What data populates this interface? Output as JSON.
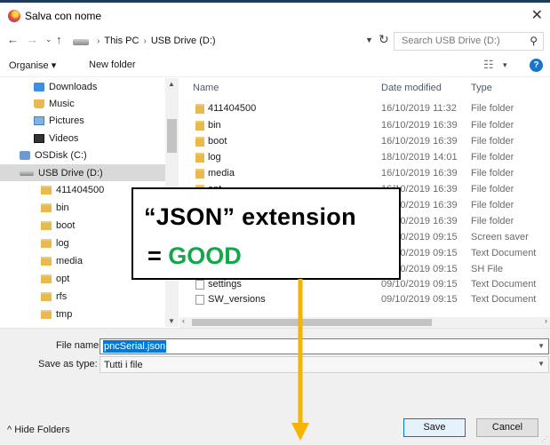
{
  "window": {
    "title": "Salva con nome",
    "close_glyph": "✕",
    "app_icon": "firefox-icon"
  },
  "nav": {
    "back_glyph": "←",
    "forward_glyph": "→",
    "recent_glyph": "⌄",
    "up_glyph": "↑",
    "breadcrumbs": [
      "This PC",
      "USB Drive (D:)"
    ],
    "breadcrumb_sep": "›",
    "refresh_glyph": "↻",
    "search_placeholder": "Search USB Drive (D:)",
    "search_glyph": "⚲"
  },
  "toolbar": {
    "organise": "Organise ▾",
    "new_folder": "New folder",
    "view_glyph": "☷",
    "view_drop": "▾",
    "help": "?"
  },
  "navpane": {
    "items": [
      {
        "label": "Downloads",
        "icon": "downloads-icon"
      },
      {
        "label": "Music",
        "icon": "music-icon"
      },
      {
        "label": "Pictures",
        "icon": "pictures-icon"
      },
      {
        "label": "Videos",
        "icon": "videos-icon"
      },
      {
        "label": "OSDisk (C:)",
        "icon": "disk-icon"
      },
      {
        "label": "USB Drive (D:)",
        "icon": "usb-drive-icon",
        "selected": true
      },
      {
        "label": "411404500",
        "icon": "folder-icon"
      },
      {
        "label": "bin",
        "icon": "folder-icon"
      },
      {
        "label": "boot",
        "icon": "folder-icon"
      },
      {
        "label": "log",
        "icon": "folder-icon"
      },
      {
        "label": "media",
        "icon": "folder-icon"
      },
      {
        "label": "opt",
        "icon": "folder-icon"
      },
      {
        "label": "rfs",
        "icon": "folder-icon"
      },
      {
        "label": "tmp",
        "icon": "folder-icon"
      }
    ]
  },
  "filelist": {
    "columns": {
      "name": "Name",
      "date": "Date modified",
      "type": "Type"
    },
    "rows": [
      {
        "name": "411404500",
        "date": "16/10/2019 11:32",
        "type": "File folder",
        "icon": "folder"
      },
      {
        "name": "bin",
        "date": "16/10/2019 16:39",
        "type": "File folder",
        "icon": "folder"
      },
      {
        "name": "boot",
        "date": "16/10/2019 16:39",
        "type": "File folder",
        "icon": "folder"
      },
      {
        "name": "log",
        "date": "18/10/2019 14:01",
        "type": "File folder",
        "icon": "folder"
      },
      {
        "name": "media",
        "date": "16/10/2019 16:39",
        "type": "File folder",
        "icon": "folder"
      },
      {
        "name": "opt",
        "date": "16/10/2019 16:39",
        "type": "File folder",
        "icon": "folder"
      },
      {
        "name": "",
        "date": "16/10/2019 16:39",
        "type": "File folder",
        "icon": "folder"
      },
      {
        "name": "",
        "date": "16/10/2019 16:39",
        "type": "File folder",
        "icon": "folder"
      },
      {
        "name": "",
        "date": "09/10/2019 09:15",
        "type": "Screen saver",
        "icon": "doc"
      },
      {
        "name": "",
        "date": "09/10/2019 09:15",
        "type": "Text Document",
        "icon": "doc"
      },
      {
        "name": "",
        "date": "09/10/2019 09:15",
        "type": "SH File",
        "icon": "doc"
      },
      {
        "name": "settings",
        "date": "09/10/2019 09:15",
        "type": "Text Document",
        "icon": "doc"
      },
      {
        "name": "SW_versions",
        "date": "09/10/2019 09:15",
        "type": "Text Document",
        "icon": "doc"
      }
    ]
  },
  "form": {
    "file_name_label": "File name:",
    "file_name_value": "pncSerial.json",
    "save_type_label": "Save as type:",
    "save_type_value": "Tutti i file",
    "hide_folders": "^ Hide Folders",
    "save": "Save",
    "cancel": "Cancel"
  },
  "callout": {
    "line1": "“JSON”  extension",
    "line2_prefix": "= ",
    "line2_good": "GOOD",
    "good_color": "#11a84a",
    "arrow_color": "#f5b400"
  }
}
